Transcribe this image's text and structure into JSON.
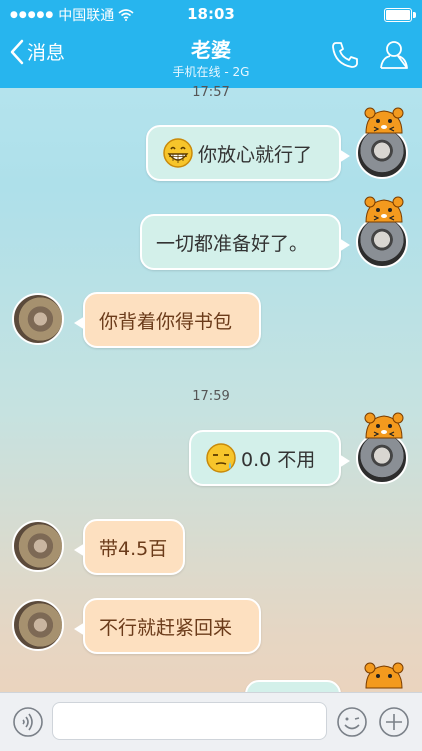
{
  "status_bar": {
    "carrier": "中国联通",
    "time": "18:03"
  },
  "header": {
    "back_label": "消息",
    "title": "老婆",
    "subtitle": "手机在线 - 2G"
  },
  "timestamps": [
    "17:57",
    "17:59"
  ],
  "messages": [
    {
      "side": "out",
      "emoji": "grin",
      "text": "你放心就行了"
    },
    {
      "side": "out",
      "text": "一切都准备好了。"
    },
    {
      "side": "in",
      "text": "你背着你得书包"
    },
    {
      "side": "out",
      "emoji": "sleepy",
      "text": "0.0  不用"
    },
    {
      "side": "in",
      "text": "带4.5百"
    },
    {
      "side": "in",
      "text": "不行就赶紧回来"
    }
  ],
  "colors": {
    "nav": "#27b5ee",
    "bubble_out": "#d3f0ea",
    "bubble_in": "#fde0c0"
  },
  "icons": {
    "back": "chevron-left-icon",
    "phone": "phone-icon",
    "profile": "profile-icon",
    "voice": "voice-icon",
    "emoji": "smile-icon",
    "more": "plus-icon"
  }
}
